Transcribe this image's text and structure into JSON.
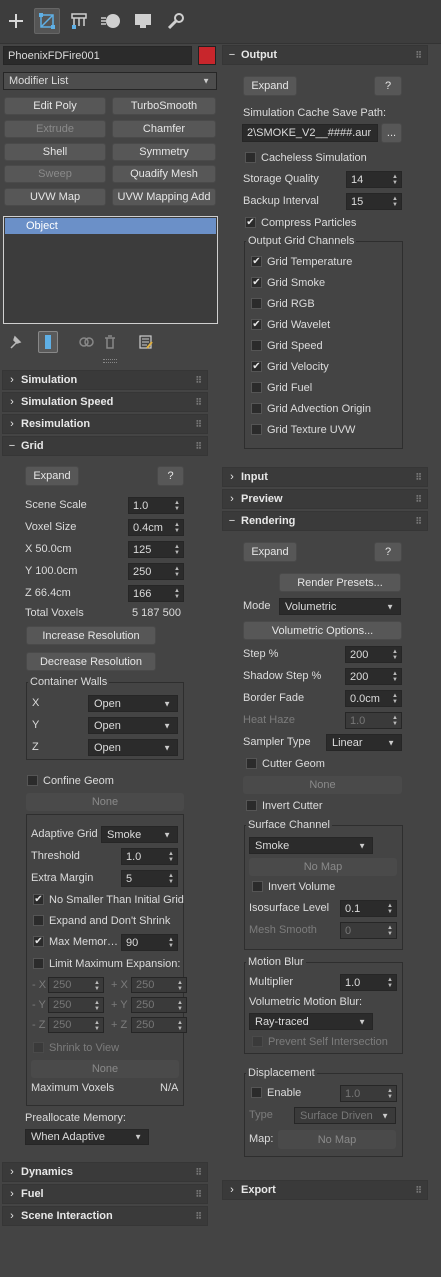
{
  "toolbar": {
    "create_icon": "plus-icon",
    "modify_icon": "modify-icon",
    "hierarchy_icon": "hierarchy-icon",
    "motion_icon": "motion-icon",
    "display_icon": "display-icon",
    "utilities_icon": "wrench-icon"
  },
  "left": {
    "object_name": "PhoenixFDFire001",
    "object_color": "#c8262c",
    "modifier_list_label": "Modifier List",
    "mod_buttons": [
      "Edit Poly",
      "TurboSmooth",
      "Extrude",
      "Chamfer",
      "Shell",
      "Symmetry",
      "Sweep",
      "Quadify Mesh",
      "UVW Map",
      "UVW Mapping Add"
    ],
    "stack_item": "Object",
    "rollouts_collapsed_top": [
      "Simulation",
      "Simulation Speed",
      "Resimulation"
    ],
    "grid": {
      "title": "Grid",
      "expand": "Expand",
      "help": "?",
      "scene_scale_label": "Scene Scale",
      "scene_scale": "1.0",
      "voxel_size_label": "Voxel Size",
      "voxel_size": "0.4cm",
      "x_label": "X  50.0cm",
      "x_val": "125",
      "y_label": "Y  100.0cm",
      "y_val": "250",
      "z_label": "Z  66.4cm",
      "z_val": "166",
      "total_voxels_label": "Total Voxels",
      "total_voxels": "5 187 500",
      "increase": "Increase Resolution",
      "decrease": "Decrease Resolution",
      "container_walls": "Container Walls",
      "wx": "X",
      "wy": "Y",
      "wz": "Z",
      "open": "Open",
      "confine_geom": "Confine Geom",
      "none": "None",
      "adaptive_grid_label": "Adaptive Grid",
      "adaptive_grid": "Smoke",
      "threshold_label": "Threshold",
      "threshold": "1.0",
      "extra_margin_label": "Extra Margin",
      "extra_margin": "5",
      "no_smaller": "No Smaller Than Initial Grid",
      "expand_dont_shrink": "Expand and Don't Shrink",
      "max_memory_label": "Max Memor…",
      "max_memory": "90",
      "limit_max_exp": "Limit Maximum Expansion:",
      "neg_x": "- X",
      "pos_x": "+ X",
      "neg_y": "- Y",
      "pos_y": "+ Y",
      "neg_z": "- Z",
      "pos_z": "+ Z",
      "exp_val": "250",
      "shrink_to_view": "Shrink to View",
      "none2": "None",
      "max_voxels_label": "Maximum Voxels",
      "max_voxels": "N/A",
      "prealloc_label": "Preallocate Memory:",
      "prealloc": "When Adaptive"
    },
    "rollouts_collapsed_bottom": [
      "Dynamics",
      "Fuel",
      "Scene Interaction"
    ]
  },
  "right": {
    "output": {
      "title": "Output",
      "expand": "Expand",
      "help": "?",
      "cache_path_label": "Simulation Cache Save Path:",
      "cache_path": "2\\SMOKE_V2__####.aur",
      "browse": "...",
      "cacheless": "Cacheless Simulation",
      "storage_quality_label": "Storage Quality",
      "storage_quality": "14",
      "backup_interval_label": "Backup Interval",
      "backup_interval": "15",
      "compress_particles": "Compress Particles",
      "channels_title": "Output Grid Channels",
      "channels": [
        {
          "label": "Grid Temperature",
          "checked": true
        },
        {
          "label": "Grid Smoke",
          "checked": true
        },
        {
          "label": "Grid RGB",
          "checked": false
        },
        {
          "label": "Grid Wavelet",
          "checked": true
        },
        {
          "label": "Grid Speed",
          "checked": false
        },
        {
          "label": "Grid Velocity",
          "checked": true
        },
        {
          "label": "Grid Fuel",
          "checked": false
        },
        {
          "label": "Grid Advection Origin",
          "checked": false
        },
        {
          "label": "Grid Texture UVW",
          "checked": false
        }
      ]
    },
    "input_title": "Input",
    "preview_title": "Preview",
    "rendering": {
      "title": "Rendering",
      "expand": "Expand",
      "help": "?",
      "render_presets": "Render Presets...",
      "mode_label": "Mode",
      "mode": "Volumetric",
      "vol_options": "Volumetric Options...",
      "step_label": "Step %",
      "step": "200",
      "shadow_step_label": "Shadow Step %",
      "shadow_step": "200",
      "border_fade_label": "Border Fade",
      "border_fade": "0.0cm",
      "heat_haze_label": "Heat Haze",
      "heat_haze": "1.0",
      "sampler_label": "Sampler Type",
      "sampler": "Linear",
      "cutter_geom": "Cutter Geom",
      "none": "None",
      "invert_cutter": "Invert Cutter",
      "surface_channel_title": "Surface Channel",
      "surface_channel": "Smoke",
      "no_map": "No Map",
      "invert_volume": "Invert Volume",
      "isosurface_label": "Isosurface Level",
      "isosurface": "0.1",
      "mesh_smooth_label": "Mesh Smooth",
      "mesh_smooth": "0",
      "motion_blur_title": "Motion Blur",
      "multiplier_label": "Multiplier",
      "multiplier": "1.0",
      "vol_motion_blur_label": "Volumetric Motion Blur:",
      "vol_motion_blur": "Ray-traced",
      "prevent_self": "Prevent Self Intersection",
      "displacement_title": "Displacement",
      "enable": "Enable",
      "enable_val": "1.0",
      "type_label": "Type",
      "type": "Surface Driven",
      "map_label": "Map:",
      "map": "No Map"
    },
    "export_title": "Export"
  }
}
